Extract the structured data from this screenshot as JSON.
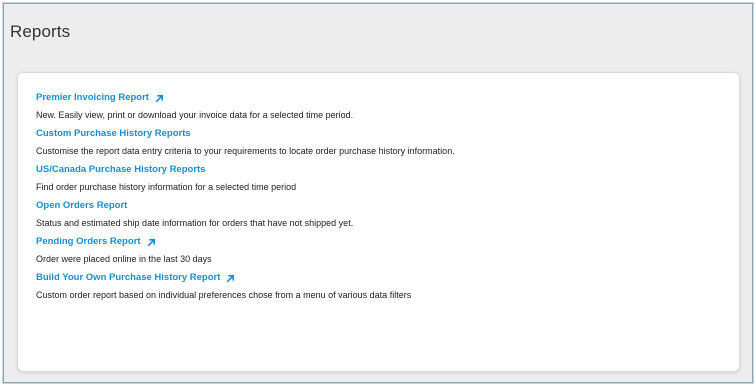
{
  "page": {
    "title": "Reports"
  },
  "colors": {
    "link": "#1a8ed1",
    "text": "#222222",
    "background": "#ededed",
    "card": "#ffffff"
  },
  "reports": [
    {
      "label": "Premier Invoicing Report",
      "external": true,
      "icon": "external-link-icon",
      "description": "New. Easily view, print or download your invoice data for a selected time period."
    },
    {
      "label": "Custom Purchase History Reports",
      "external": false,
      "description": "Customise the report data entry criteria to your requirements to locate order purchase history information."
    },
    {
      "label": "US/Canada Purchase History Reports",
      "external": false,
      "description": "Find order purchase history information for a selected time period"
    },
    {
      "label": "Open Orders Report",
      "external": false,
      "description": "Status and estimated ship date information for orders that have not shipped yet."
    },
    {
      "label": "Pending Orders Report",
      "external": true,
      "icon": "external-link-icon",
      "description": "Order were placed online in the last 30 days"
    },
    {
      "label": "Build Your Own Purchase History Report",
      "external": true,
      "icon": "external-link-icon",
      "description": "Custom order report based on individual preferences chose from a menu of various data filters"
    }
  ]
}
